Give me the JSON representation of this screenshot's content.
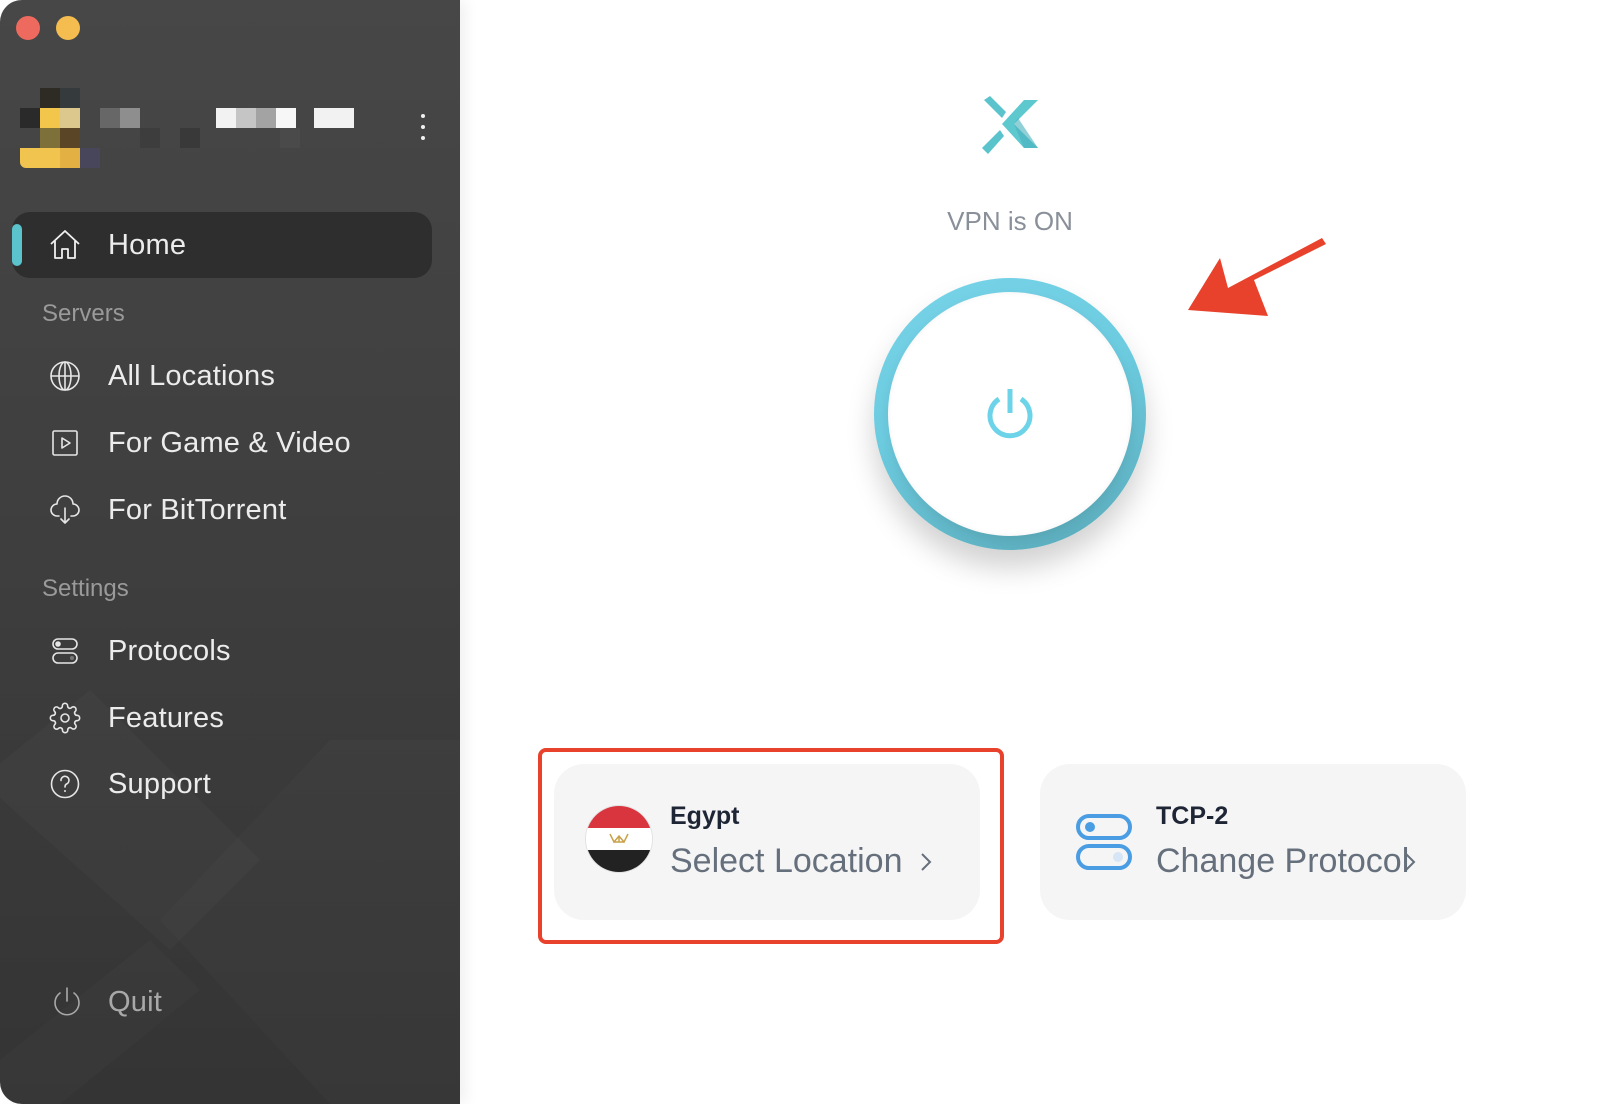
{
  "window": {
    "controls": [
      "close",
      "minimize"
    ]
  },
  "account": {
    "name_redacted": true,
    "menu_icon": "more-vertical-icon"
  },
  "sidebar": {
    "active_accent_color": "#5bc3cc",
    "home": {
      "label": "Home",
      "icon": "home-icon",
      "active": true
    },
    "sections": [
      {
        "title": "Servers",
        "items": [
          {
            "label": "All Locations",
            "icon": "globe-icon"
          },
          {
            "label": "For Game & Video",
            "icon": "play-square-icon"
          },
          {
            "label": "For BitTorrent",
            "icon": "cloud-download-icon"
          }
        ]
      },
      {
        "title": "Settings",
        "items": [
          {
            "label": "Protocols",
            "icon": "toggles-icon"
          },
          {
            "label": "Features",
            "icon": "gear-icon"
          },
          {
            "label": "Support",
            "icon": "question-circle-icon"
          }
        ]
      }
    ],
    "quit": {
      "label": "Quit",
      "icon": "power-icon"
    }
  },
  "main": {
    "brand_color": "#5bc3cc",
    "status": "VPN is ON",
    "power_button": {
      "state": "on",
      "icon": "power-icon"
    },
    "location_card": {
      "country": "Egypt",
      "action": "Select Location",
      "flag": "egypt-flag",
      "highlighted": true,
      "highlight_color": "#e8412c"
    },
    "protocol_card": {
      "protocol": "TCP-2",
      "action": "Change Protocol",
      "icon": "toggles-icon",
      "icon_color": "#4a9de3"
    },
    "annotation_arrow_color": "#e8412c"
  }
}
